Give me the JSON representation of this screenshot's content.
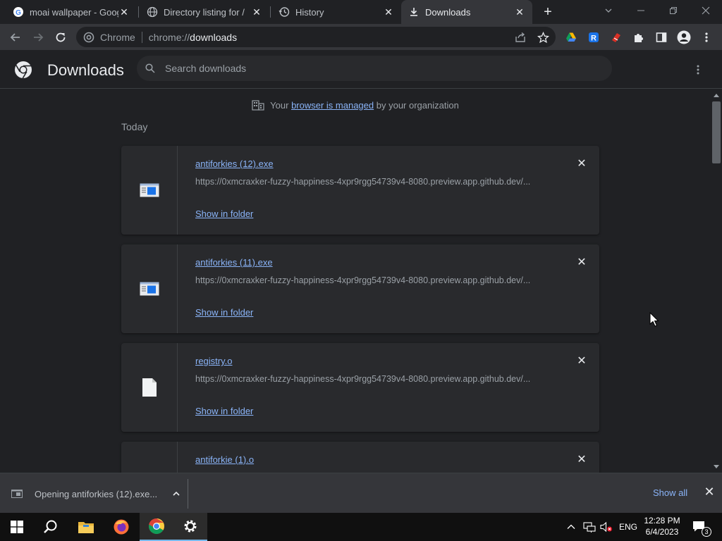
{
  "tabs": [
    {
      "title": "moai wallpaper - Google Search",
      "active": false
    },
    {
      "title": "Directory listing for /",
      "active": false
    },
    {
      "title": "History",
      "active": false
    },
    {
      "title": "Downloads",
      "active": true
    }
  ],
  "omnibox": {
    "site_label": "Chrome",
    "url_prefix": "chrome://",
    "url_host": "downloads"
  },
  "downloads_page": {
    "title": "Downloads",
    "search_placeholder": "Search downloads",
    "managed_notice": {
      "before": "Your",
      "link": "browser is managed",
      "after": "by your organization"
    },
    "section_label": "Today",
    "items": [
      {
        "name": "antiforkies (12).exe",
        "url": "https://0xmcraxker-fuzzy-happiness-4xpr9rgg54739v4-8080.preview.app.github.dev/...",
        "action": "Show in folder",
        "icon": "exe-file-icon"
      },
      {
        "name": "antiforkies (11).exe",
        "url": "https://0xmcraxker-fuzzy-happiness-4xpr9rgg54739v4-8080.preview.app.github.dev/...",
        "action": "Show in folder",
        "icon": "exe-file-icon"
      },
      {
        "name": "registry.o",
        "url": "https://0xmcraxker-fuzzy-happiness-4xpr9rgg54739v4-8080.preview.app.github.dev/...",
        "action": "Show in folder",
        "icon": "generic-file-icon"
      },
      {
        "name": "antiforkie (1).o",
        "url": "",
        "action": "",
        "icon": "generic-file-icon"
      }
    ]
  },
  "download_shelf": {
    "item_label": "Opening antiforkies (12).exe...",
    "show_all": "Show all"
  },
  "taskbar": {
    "language": "ENG",
    "time": "12:28 PM",
    "date": "6/4/2023",
    "notification_count": "3"
  },
  "colors": {
    "link": "#8ab4f8",
    "background": "#202124",
    "toolbar": "#35363a"
  }
}
